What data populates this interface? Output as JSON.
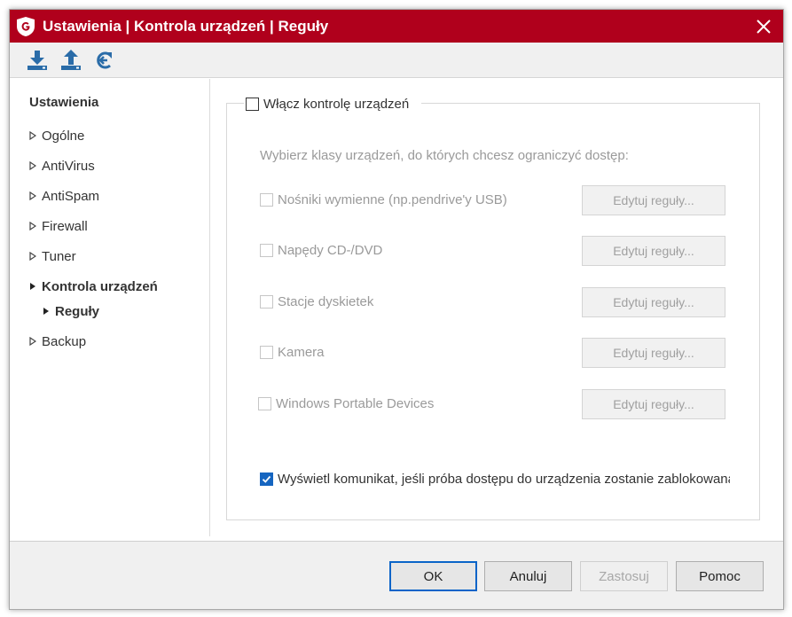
{
  "window": {
    "title": "Ustawienia | Kontrola urządzeń | Reguły",
    "accent_color": "#b0001c",
    "logo_icon": "g-data-shield-icon",
    "close_icon": "close-icon"
  },
  "toolbar": {
    "buttons": [
      {
        "icon": "import-download-icon"
      },
      {
        "icon": "export-upload-icon"
      },
      {
        "icon": "reset-arrow-icon"
      }
    ]
  },
  "sidebar": {
    "header": "Ustawienia",
    "items": [
      {
        "label": "Ogólne",
        "expanded": false,
        "active": false
      },
      {
        "label": "AntiVirus",
        "expanded": false,
        "active": false
      },
      {
        "label": "AntiSpam",
        "expanded": false,
        "active": false
      },
      {
        "label": "Firewall",
        "expanded": false,
        "active": false
      },
      {
        "label": "Tuner",
        "expanded": false,
        "active": false
      },
      {
        "label": "Kontrola urządzeń",
        "expanded": true,
        "active": true
      },
      {
        "label": "Reguły",
        "expanded": false,
        "active": true,
        "child": true
      },
      {
        "label": "Backup",
        "expanded": false,
        "active": false
      }
    ]
  },
  "main": {
    "enable_label": "Włącz kontrolę urządzeń",
    "enable_checked": false,
    "hint": "Wybierz klasy urządzeń, do których chcesz ograniczyć dostęp:",
    "devices": [
      {
        "label": "Nośniki wymienne (np.pendrive'y USB)",
        "checked": false,
        "button": "Edytuj reguły..."
      },
      {
        "label": "Napędy CD-/DVD",
        "checked": false,
        "button": "Edytuj reguły..."
      },
      {
        "label": "Stacje dyskietek",
        "checked": false,
        "button": "Edytuj reguły..."
      },
      {
        "label": "Kamera",
        "checked": false,
        "button": "Edytuj reguły..."
      },
      {
        "label": "Windows Portable Devices",
        "checked": false,
        "button": "Edytuj reguły..."
      }
    ],
    "notify_label": "Wyświetl komunikat, jeśli próba dostępu do urządzenia zostanie zablokowana",
    "notify_checked": true
  },
  "footer": {
    "ok": "OK",
    "cancel": "Anuluj",
    "apply": "Zastosuj",
    "help": "Pomoc"
  }
}
